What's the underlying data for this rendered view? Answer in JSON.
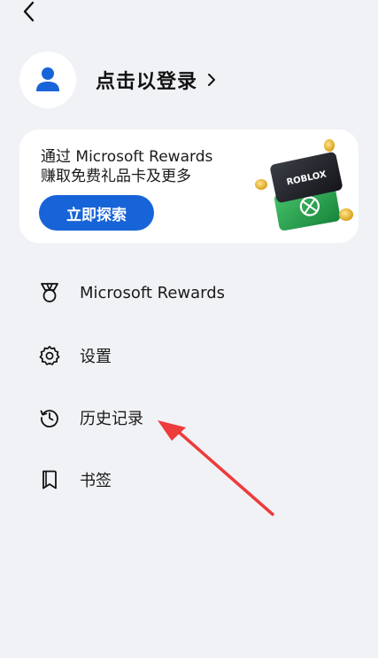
{
  "header": {
    "back_icon": "chevron-left-icon"
  },
  "profile": {
    "avatar_icon": "user-icon",
    "login_label": "点击以登录",
    "chevron_icon": "chevron-right-icon"
  },
  "rewards_card": {
    "line1": "通过 Microsoft Rewards",
    "line2": "赚取免费礼品卡及更多",
    "button_label": "立即探索",
    "gift_card_brand": "ROBLOX"
  },
  "menu": {
    "items": [
      {
        "label": "Microsoft Rewards",
        "icon": "medal-icon"
      },
      {
        "label": "设置",
        "icon": "gear-icon"
      },
      {
        "label": "历史记录",
        "icon": "history-icon"
      },
      {
        "label": "书签",
        "icon": "bookmark-icon"
      }
    ]
  },
  "colors": {
    "background": "#f1f2f6",
    "accent": "#1763d8",
    "annotation_arrow": "#ee3b3b"
  }
}
